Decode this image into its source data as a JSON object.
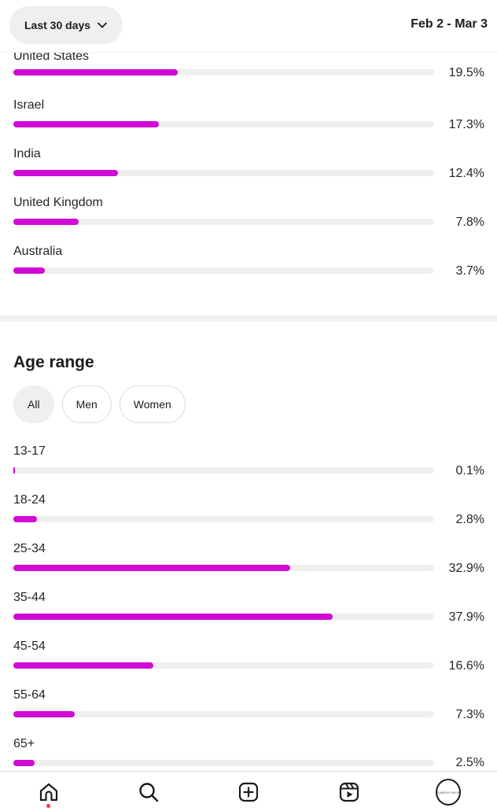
{
  "header": {
    "range_label": "Last 30 days",
    "date_range": "Feb 2 - Mar 3"
  },
  "countries": [
    {
      "label": "United States",
      "value": "19.5%",
      "fraction": 0.195
    },
    {
      "label": "Israel",
      "value": "17.3%",
      "fraction": 0.173
    },
    {
      "label": "India",
      "value": "12.4%",
      "fraction": 0.124
    },
    {
      "label": "United Kingdom",
      "value": "7.8%",
      "fraction": 0.078
    },
    {
      "label": "Australia",
      "value": "3.7%",
      "fraction": 0.037
    }
  ],
  "age_section": {
    "title": "Age range",
    "filters": [
      {
        "label": "All",
        "active": true
      },
      {
        "label": "Men",
        "active": false
      },
      {
        "label": "Women",
        "active": false
      }
    ],
    "rows": [
      {
        "label": "13-17",
        "value": "0.1%",
        "fraction": 0.001
      },
      {
        "label": "18-24",
        "value": "2.8%",
        "fraction": 0.028
      },
      {
        "label": "25-34",
        "value": "32.9%",
        "fraction": 0.329
      },
      {
        "label": "35-44",
        "value": "37.9%",
        "fraction": 0.379
      },
      {
        "label": "45-54",
        "value": "16.6%",
        "fraction": 0.166
      },
      {
        "label": "55-64",
        "value": "7.3%",
        "fraction": 0.073
      },
      {
        "label": "65+",
        "value": "2.5%",
        "fraction": 0.025
      }
    ]
  },
  "bottom_nav": {
    "items": [
      "home-icon",
      "search-icon",
      "create-icon",
      "reels-icon",
      "profile-avatar"
    ],
    "avatar_text": "SAMPLE SHOP"
  },
  "colors": {
    "bar_fill": "#d10ad6",
    "bar_track": "#efeff1",
    "notification_dot": "#ff3040"
  }
}
